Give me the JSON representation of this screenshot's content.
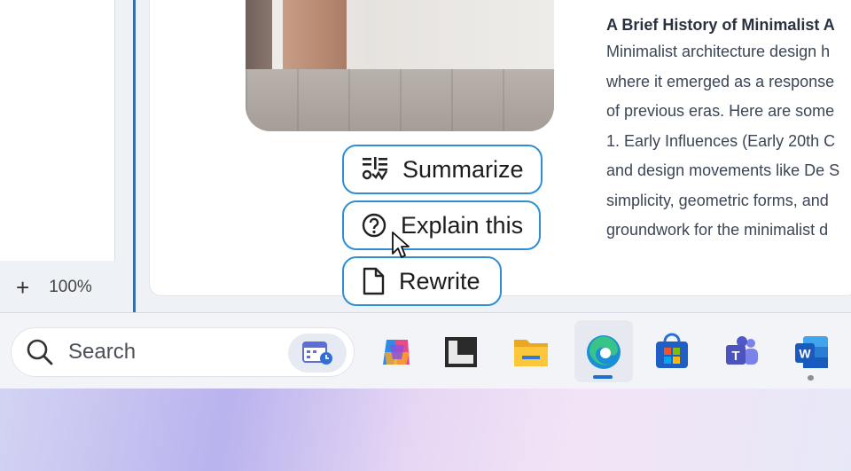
{
  "sidebar": {
    "zoom_add": "+",
    "zoom_level": "100%"
  },
  "document": {
    "heading": "A Brief History of Minimalist A",
    "paragraph_lines": [
      "Minimalist architecture design h",
      "where it emerged as a response",
      "of previous eras. Here are some",
      "1. Early Influences (Early 20th C",
      "and design movements like De S",
      "simplicity, geometric forms, and",
      "groundwork for the minimalist d"
    ]
  },
  "ai_actions": [
    {
      "label": "Summarize",
      "icon": "summarize-icon"
    },
    {
      "label": "Explain this",
      "icon": "question-circle-icon"
    },
    {
      "label": "Rewrite",
      "icon": "document-icon"
    }
  ],
  "taskbar": {
    "search_placeholder": "Search",
    "apps": [
      "copilot-icon",
      "terminal-icon",
      "file-explorer-icon",
      "edge-icon",
      "store-icon",
      "teams-icon",
      "word-icon"
    ],
    "accent": "#1c6fd1"
  }
}
